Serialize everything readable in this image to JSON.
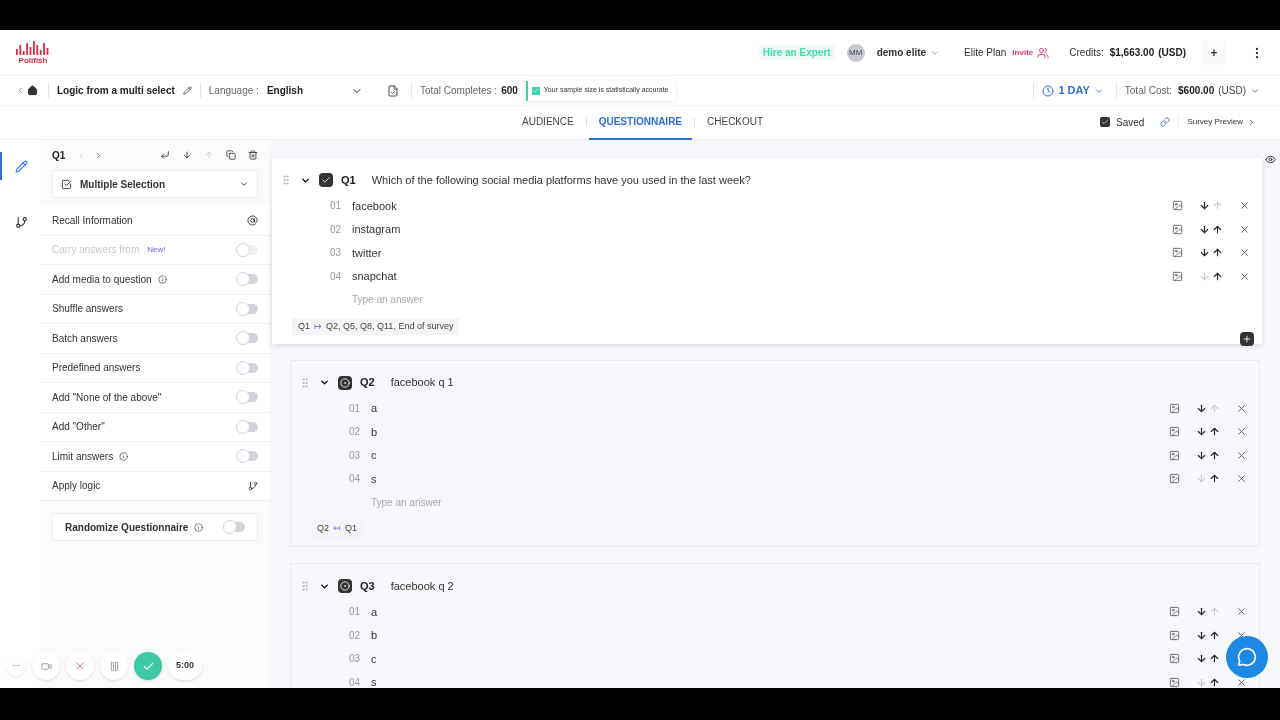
{
  "header": {
    "logo": "Pollfish",
    "hire": "Hire an Expert",
    "avatar": "MM",
    "user": "demo elite",
    "plan": "Elite Plan",
    "invite": "Invite",
    "credits_label": "Credits:",
    "credits": "$1,663.00",
    "credits_unit": "(USD)",
    "add": "+"
  },
  "toolbar": {
    "survey_name": "Logic from a multi select",
    "language_label": "Language :",
    "language": "English",
    "completes_label": "Total Completes :",
    "completes": "600",
    "sample_note": "Your sample size is statistically accurate",
    "duration": "1 DAY",
    "cost_label": "Total Cost:",
    "cost": "$600.00",
    "cost_unit": "(USD)"
  },
  "tabs": [
    {
      "label": "AUDIENCE",
      "selected": false
    },
    {
      "label": "QUESTIONNAIRE",
      "selected": true
    },
    {
      "label": "CHECKOUT",
      "selected": false
    }
  ],
  "saved": {
    "label": "Saved",
    "checked": true
  },
  "preview": "Survey Preview",
  "rail": [
    {
      "kind": "edit",
      "selected": true
    },
    {
      "kind": "logic",
      "selected": false
    }
  ],
  "editor": {
    "question": "Q1",
    "type": "Multiple Selection",
    "options": [
      {
        "label": "Recall Information",
        "kind": "recall"
      },
      {
        "label": "Carry answers from",
        "kind": "toggle",
        "on": false,
        "disabled": true,
        "badge": "New!"
      },
      {
        "label": "Add media to question",
        "kind": "toggle",
        "on": false,
        "disabled": false,
        "info": true
      },
      {
        "label": "Shuffle answers",
        "kind": "toggle",
        "on": false,
        "disabled": false
      },
      {
        "label": "Batch answers",
        "kind": "toggle",
        "on": false,
        "disabled": false
      },
      {
        "label": "Predefined answers",
        "kind": "toggle",
        "on": false,
        "disabled": false
      },
      {
        "label": "Add \"None of the above\"",
        "kind": "toggle",
        "on": false,
        "disabled": false
      },
      {
        "label": "Add \"Other\"",
        "kind": "toggle",
        "on": false,
        "disabled": false
      },
      {
        "label": "Limit answers",
        "kind": "toggle",
        "on": false,
        "disabled": false,
        "info": true
      },
      {
        "label": "Apply logic",
        "kind": "logic"
      }
    ],
    "randomize": {
      "label": "Randomize Questionnaire",
      "on": false
    }
  },
  "questions": [
    {
      "id": "Q1",
      "text": "Which of the following social media platforms have you used in the last week?",
      "kind": "multi",
      "selected": true,
      "answers": [
        {
          "num": "01",
          "text": "facebook",
          "can_down": true,
          "can_up": false
        },
        {
          "num": "02",
          "text": "instagram",
          "can_down": true,
          "can_up": true
        },
        {
          "num": "03",
          "text": "twitter",
          "can_down": true,
          "can_up": true
        },
        {
          "num": "04",
          "text": "snapchat",
          "can_down": false,
          "can_up": true
        }
      ],
      "placeholder": "Type an answer",
      "logic_from": "Q1",
      "logic_arrow": "↦",
      "logic_to": "Q2, Q5, Q8, Q11, End of survey"
    },
    {
      "id": "Q2",
      "text": "facebook q 1",
      "kind": "single",
      "selected": false,
      "answers": [
        {
          "num": "01",
          "text": "a",
          "can_down": true,
          "can_up": false
        },
        {
          "num": "02",
          "text": "b",
          "can_down": true,
          "can_up": true
        },
        {
          "num": "03",
          "text": "c",
          "can_down": true,
          "can_up": true
        },
        {
          "num": "04",
          "text": "s",
          "can_down": false,
          "can_up": true
        }
      ],
      "placeholder": "Type an answer",
      "logic_from": "Q2",
      "logic_arrow": "↤",
      "logic_to": "Q1"
    },
    {
      "id": "Q3",
      "text": "facebook q 2",
      "kind": "single",
      "selected": false,
      "answers": [
        {
          "num": "01",
          "text": "a",
          "can_down": true,
          "can_up": false
        },
        {
          "num": "02",
          "text": "b",
          "can_down": true,
          "can_up": true
        },
        {
          "num": "03",
          "text": "c",
          "can_down": true,
          "can_up": true
        },
        {
          "num": "04",
          "text": "s",
          "can_down": false,
          "can_up": true
        }
      ]
    }
  ],
  "recorder": {
    "more": "···",
    "time": "5:00"
  }
}
